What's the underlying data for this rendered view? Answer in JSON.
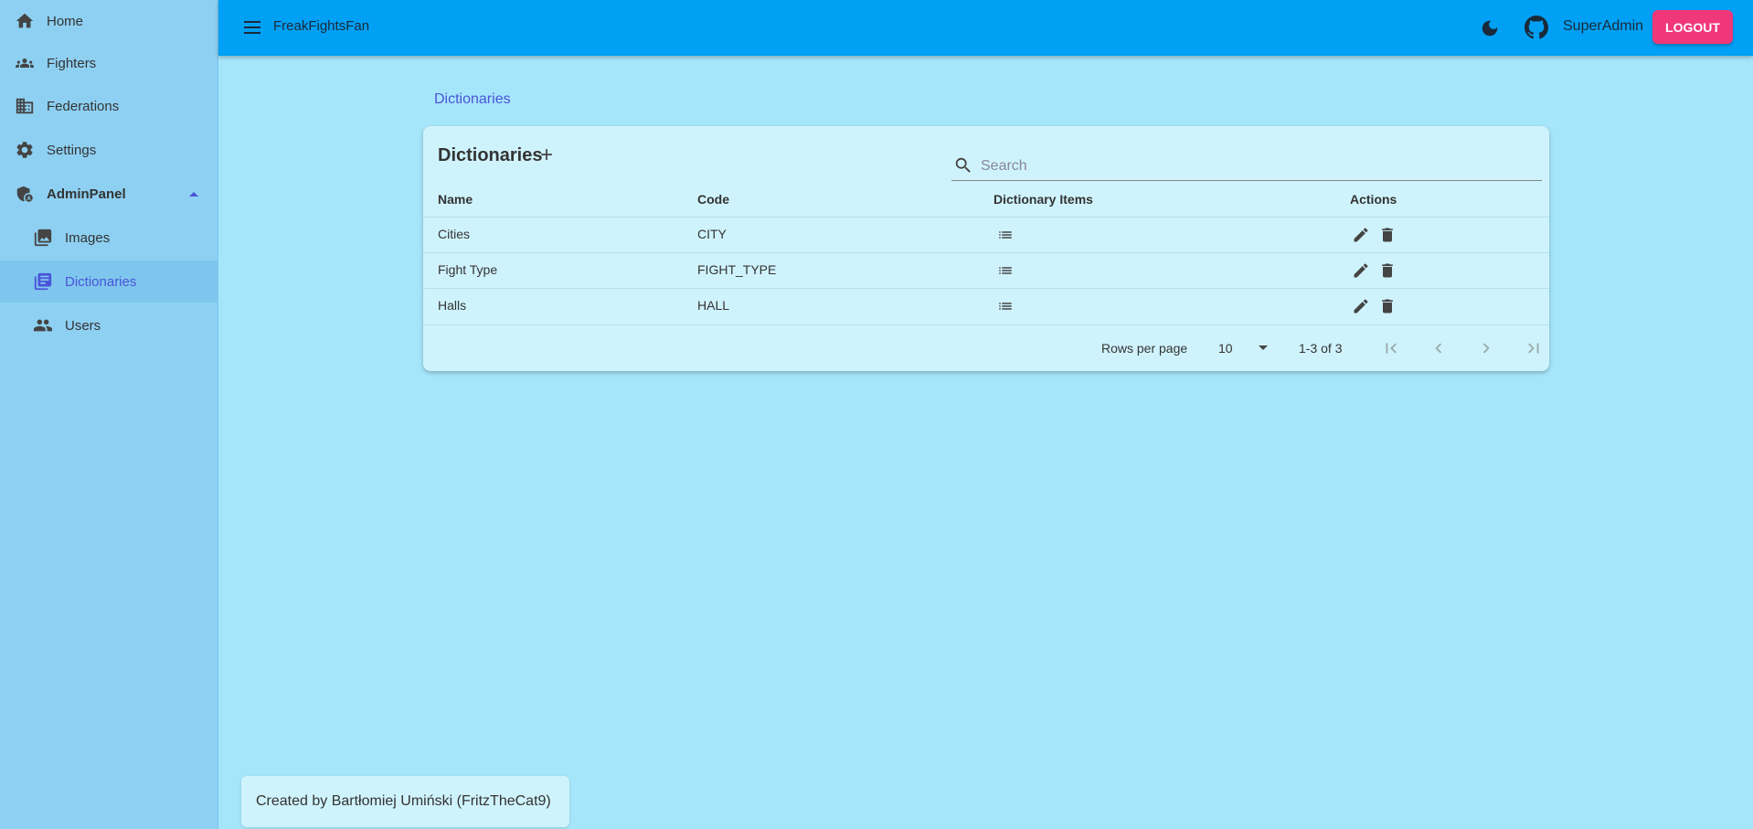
{
  "app": {
    "title": "FreakFightsFan",
    "user": "SuperAdmin",
    "logout_label": "LOGOUT"
  },
  "sidebar": {
    "items": [
      {
        "label": "Home",
        "icon": "home-icon"
      },
      {
        "label": "Fighters",
        "icon": "groups-icon"
      },
      {
        "label": "Federations",
        "icon": "building-icon"
      },
      {
        "label": "Settings",
        "icon": "gear-icon"
      },
      {
        "label": "AdminPanel",
        "icon": "admin-shield-icon",
        "expanded": true
      },
      {
        "label": "Images",
        "icon": "images-icon"
      },
      {
        "label": "Dictionaries",
        "icon": "library-books-icon",
        "active": true
      },
      {
        "label": "Users",
        "icon": "users-icon"
      }
    ]
  },
  "breadcrumb": "Dictionaries",
  "table": {
    "title": "Dictionaries",
    "add_label": "+",
    "search_placeholder": "Search",
    "columns": [
      "Name",
      "Code",
      "Dictionary Items",
      "Actions"
    ],
    "rows": [
      {
        "name": "Cities",
        "code": "CITY"
      },
      {
        "name": "Fight Type",
        "code": "FIGHT_TYPE"
      },
      {
        "name": "Halls",
        "code": "HALL"
      }
    ],
    "rows_per_page_label": "Rows per page",
    "rows_per_page": "10",
    "range": "1-3 of 3"
  },
  "footer": {
    "credit": "Created by Bartłomiej Umiński (FritzTheCat9)"
  },
  "colors": {
    "appbar": "#00a0f5",
    "sidebar": "#8ed0f2",
    "background": "#a6e6fb",
    "accent": "#4a54d8",
    "logout": "#f0377a"
  }
}
